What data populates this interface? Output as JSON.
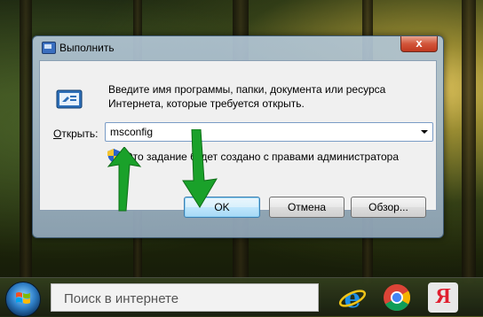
{
  "dialog": {
    "title": "Выполнить",
    "close_label": "x",
    "description_line1": "Введите имя программы, папки, документа или ресурса",
    "description_line2": "Интернета, которые требуется открыть.",
    "open_label_prefix": "",
    "open_label_underlined": "О",
    "open_label_rest": "ткрыть:",
    "input_value": "msconfig",
    "admin_text": "Это задание будет создано с правами администратора",
    "buttons": {
      "ok": "OK",
      "cancel": "Отмена",
      "browse": "Обзор..."
    }
  },
  "taskbar": {
    "search_placeholder": "Поиск в интернете",
    "pinned": [
      "internet-explorer-icon",
      "chrome-icon",
      "yandex-browser-icon"
    ],
    "yandex_letter": "Я"
  },
  "colors": {
    "arrow_green": "#1aa12a",
    "ok_border": "#3c7fb1",
    "close_red": "#c0391f"
  }
}
